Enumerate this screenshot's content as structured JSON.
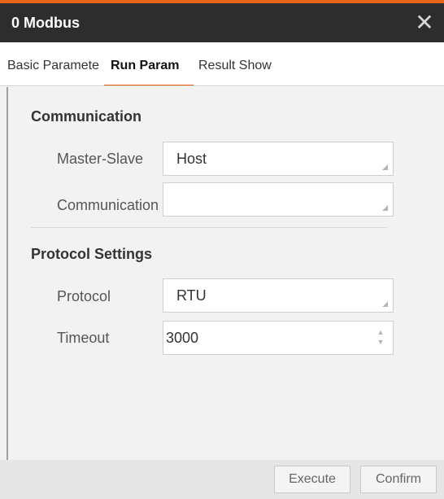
{
  "window": {
    "title": "0 Modbus",
    "close_icon": "close-icon"
  },
  "tabs": [
    {
      "label": "Basic Parameters",
      "active": false
    },
    {
      "label": "Run Param",
      "active": true
    },
    {
      "label": "Result Show",
      "active": false
    }
  ],
  "communication": {
    "title": "Communication",
    "master_slave_label": "Master-Slave",
    "master_slave_value": "Host",
    "communication_label": "Communication",
    "communication_value": ""
  },
  "protocol_settings": {
    "title": "Protocol Settings",
    "protocol_label": "Protocol",
    "protocol_value": "RTU",
    "timeout_label": "Timeout",
    "timeout_value": "3000"
  },
  "footer": {
    "execute_label": "Execute",
    "confirm_label": "Confirm"
  },
  "colors": {
    "accent": "#e8641b",
    "titlebar": "#2d2d2d",
    "panel": "#f2f2f2"
  }
}
